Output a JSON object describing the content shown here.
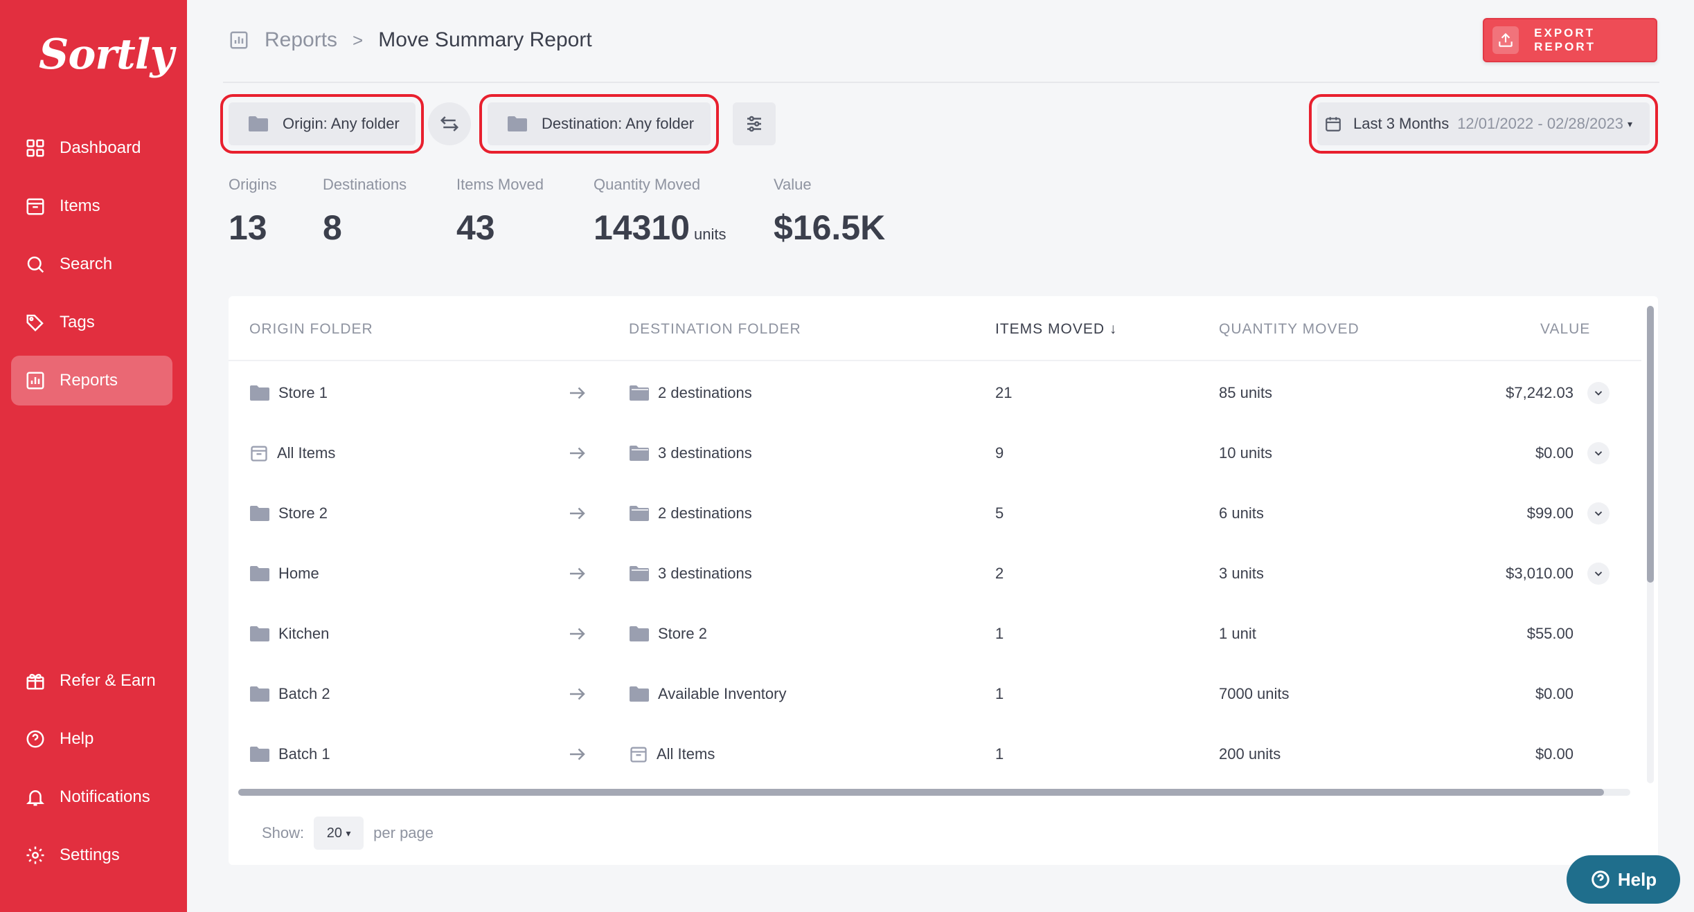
{
  "app": {
    "logo": "Sortly"
  },
  "sidebar": {
    "items": [
      {
        "label": "Dashboard",
        "icon": "dashboard-icon",
        "active": false
      },
      {
        "label": "Items",
        "icon": "items-icon",
        "active": false
      },
      {
        "label": "Search",
        "icon": "search-icon",
        "active": false
      },
      {
        "label": "Tags",
        "icon": "tag-icon",
        "active": false
      },
      {
        "label": "Reports",
        "icon": "reports-icon",
        "active": true
      }
    ],
    "bottom_items": [
      {
        "label": "Refer & Earn",
        "icon": "gift-icon"
      },
      {
        "label": "Help",
        "icon": "help-icon"
      },
      {
        "label": "Notifications",
        "icon": "bell-icon"
      },
      {
        "label": "Settings",
        "icon": "gear-icon"
      }
    ]
  },
  "header": {
    "breadcrumb_parent": "Reports",
    "breadcrumb_separator": ">",
    "title": "Move Summary Report",
    "export_label": "EXPORT REPORT"
  },
  "filters": {
    "origin": "Origin: Any folder",
    "destination": "Destination: Any folder",
    "date_preset": "Last 3 Months",
    "date_range": "12/01/2022 - 02/28/2023"
  },
  "stats": {
    "origins_label": "Origins",
    "origins_value": "13",
    "destinations_label": "Destinations",
    "destinations_value": "8",
    "items_moved_label": "Items Moved",
    "items_moved_value": "43",
    "quantity_label": "Quantity Moved",
    "quantity_value": "14310",
    "quantity_unit": "units",
    "value_label": "Value",
    "value_value": "$16.5K"
  },
  "table": {
    "columns": {
      "origin": "ORIGIN FOLDER",
      "destination": "DESTINATION FOLDER",
      "items_moved": "ITEMS MOVED",
      "quantity": "QUANTITY MOVED",
      "value": "VALUE"
    },
    "sort_indicator": "↓",
    "rows": [
      {
        "origin": "Store 1",
        "destination": "2 destinations",
        "items": "21",
        "quantity": "85 units",
        "value": "$7,242.03"
      },
      {
        "origin": "All Items",
        "destination": "3 destinations",
        "items": "9",
        "quantity": "10 units",
        "value": "$0.00"
      },
      {
        "origin": "Store 2",
        "destination": "2 destinations",
        "items": "5",
        "quantity": "6 units",
        "value": "$99.00"
      },
      {
        "origin": "Home",
        "destination": "3 destinations",
        "items": "2",
        "quantity": "3 units",
        "value": "$3,010.00"
      },
      {
        "origin": "Kitchen",
        "destination": "Store 2",
        "items": "1",
        "quantity": "1 unit",
        "value": "$55.00"
      },
      {
        "origin": "Batch 2",
        "destination": "Available Inventory",
        "items": "1",
        "quantity": "7000 units",
        "value": "$0.00"
      },
      {
        "origin": "Batch 1",
        "destination": "All Items",
        "items": "1",
        "quantity": "200 units",
        "value": "$0.00"
      }
    ]
  },
  "pager": {
    "show_label": "Show:",
    "per_page_value": "20",
    "per_page_label": "per page"
  },
  "help_button": {
    "label": "Help"
  },
  "colors": {
    "brand": "#e22f3f",
    "highlight": "#e8202e",
    "help": "#1f6e8c"
  }
}
